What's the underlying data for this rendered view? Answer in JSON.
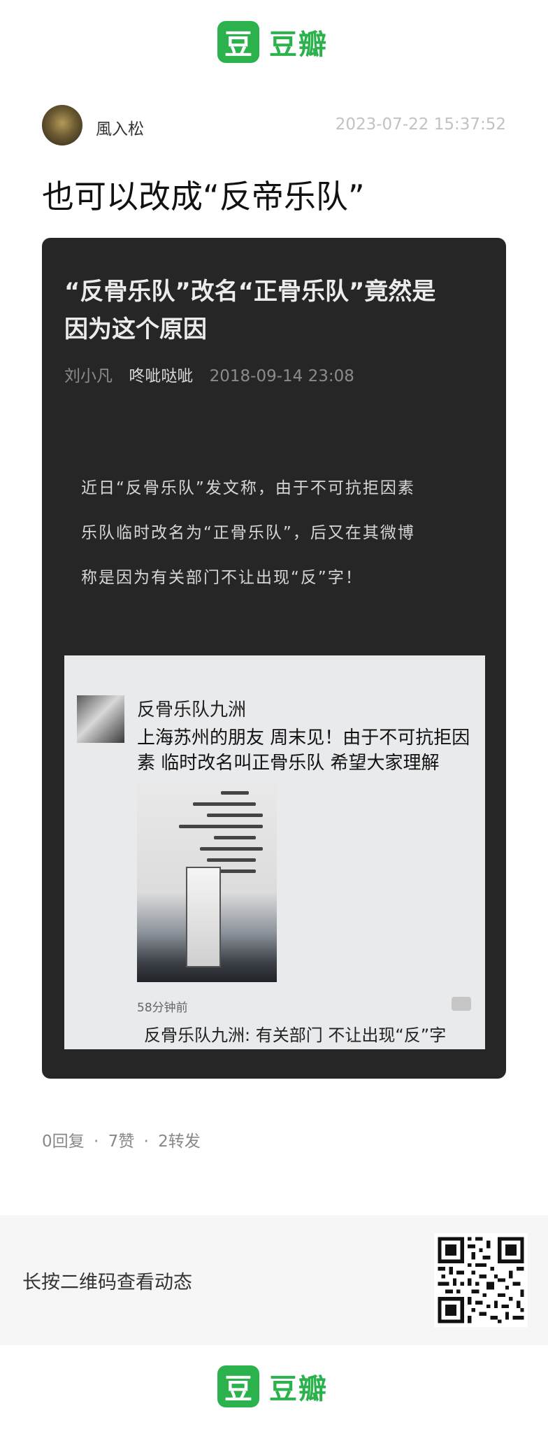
{
  "app": {
    "logo_char": "豆",
    "name": "豆瓣"
  },
  "post": {
    "user_name": "風入松",
    "timestamp": "2023-07-22 15:37:52",
    "title": "也可以改成“反帝乐队”"
  },
  "shared_article": {
    "title_line1": "“反骨乐队”改名“正骨乐队”竟然是",
    "title_line2": "因为这个原因",
    "author": "刘小凡",
    "source": "咚呲哒呲",
    "date": "2018-09-14 23:08",
    "body_lines": [
      "近日“反骨乐队”发文称，由于不可抗拒因素",
      "乐队临时改名为“正骨乐队”，后又在其微博",
      "称是因为有关部门不让出现“反”字！"
    ],
    "screenshot": {
      "account": "反骨乐队九洲",
      "text_line1": "上海苏州的朋友 周末见！由于不可抗拒因",
      "text_line2": "素 临时改名叫正骨乐队 希望大家理解",
      "time_ago": "58分钟前",
      "reply": "反骨乐队九洲: 有关部门 不让出现“反”字"
    }
  },
  "stats": {
    "replies": "0回复",
    "likes": "7赞",
    "reposts": "2转发",
    "separator": "·"
  },
  "footer": {
    "qr_hint": "长按二维码查看动态"
  },
  "colors": {
    "brand_green": "#2bb24c",
    "card_bg": "#262626"
  }
}
